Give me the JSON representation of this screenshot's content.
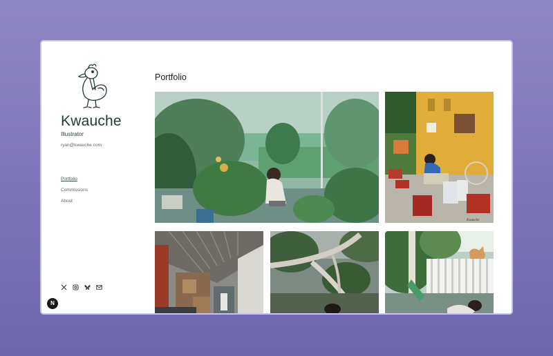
{
  "brand": {
    "name": "Kwauche",
    "role": "Illustrator",
    "email": "ryan@kwauche.com"
  },
  "nav": [
    {
      "label": "Portfolio",
      "active": true
    },
    {
      "label": "Commissions",
      "active": false
    },
    {
      "label": "About",
      "active": false
    }
  ],
  "social": [
    "x-icon",
    "instagram-icon",
    "bluesky-icon",
    "mail-icon"
  ],
  "badge": {
    "label": "N"
  },
  "main": {
    "title": "Portfolio"
  },
  "gallery": [
    {
      "name": "garden-rain-painting"
    },
    {
      "name": "street-vendor-yellow-wall-painting",
      "signature": "Kwauche"
    },
    {
      "name": "corrugated-roof-alley-painting"
    },
    {
      "name": "tree-branches-painting"
    },
    {
      "name": "fence-cat-painting"
    }
  ],
  "colors": {
    "accent": "#1f3b2f",
    "background": "#8f86c4"
  }
}
